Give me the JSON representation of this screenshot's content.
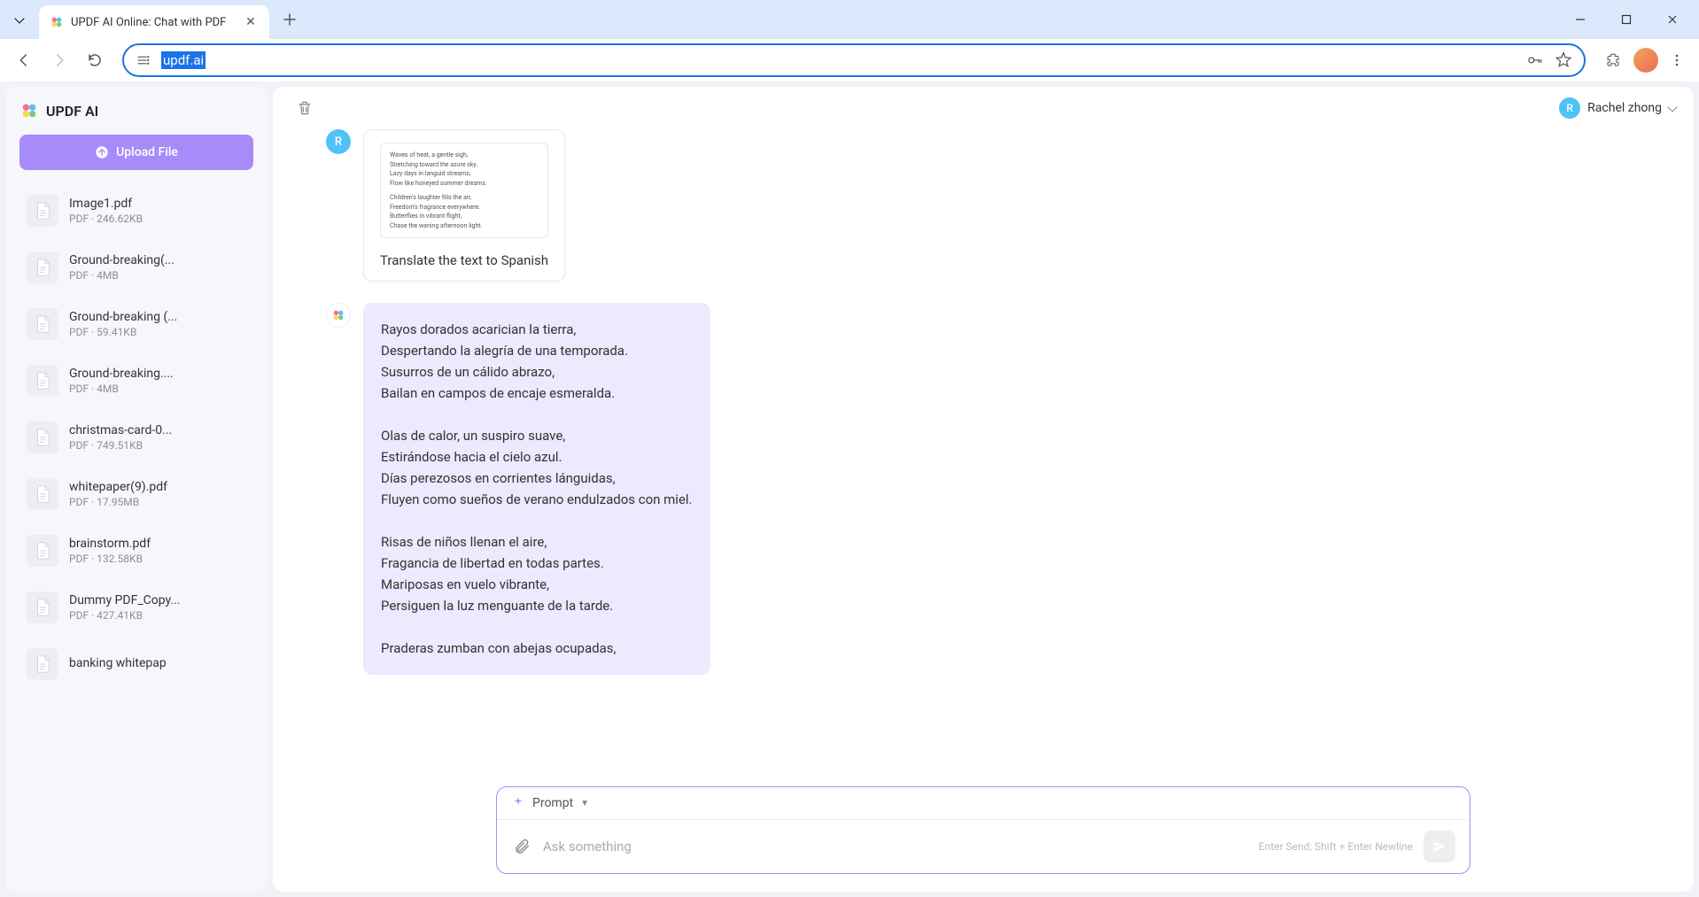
{
  "browser": {
    "tab_title": "UPDF AI Online: Chat with PDF",
    "url": "updf.ai"
  },
  "sidebar": {
    "title": "UPDF AI",
    "upload_label": "Upload File",
    "files": [
      {
        "name": "Image1.pdf",
        "meta": "PDF · 246.62KB"
      },
      {
        "name": "Ground-breaking(...",
        "meta": "PDF · 4MB"
      },
      {
        "name": "Ground-breaking (...",
        "meta": "PDF · 59.41KB"
      },
      {
        "name": "Ground-breaking....",
        "meta": "PDF · 4MB"
      },
      {
        "name": "christmas-card-0...",
        "meta": "PDF · 749.51KB"
      },
      {
        "name": "whitepaper(9).pdf",
        "meta": "PDF · 17.95MB"
      },
      {
        "name": "brainstorm.pdf",
        "meta": "PDF · 132.58KB"
      },
      {
        "name": "Dummy PDF_Copy...",
        "meta": "PDF · 427.41KB"
      },
      {
        "name": "banking whitepap",
        "meta": ""
      }
    ]
  },
  "header": {
    "user_initial": "R",
    "user_name": "Rachel zhong"
  },
  "chat": {
    "user_initial": "R",
    "user_message": "Translate the text to Spanish",
    "thumb_lines": [
      "Waves of heat, a gentle sigh,",
      "Stretching toward the azure sky.",
      "Lazy days in languid streams,",
      "Flow like honeyed summer dreams.",
      "",
      "Children's laughter fills the air,",
      "Freedom's fragrance everywhere.",
      "Butterflies in vibrant flight,",
      "Chase the waning afternoon light."
    ],
    "ai_response": "Rayos dorados acarician la tierra,\nDespertando la alegría de una temporada.\nSusurros de un cálido abrazo,\nBailan en campos de encaje esmeralda.\n\nOlas de calor, un suspiro suave,\nEstirándose hacia el cielo azul.\nDías perezosos en corrientes lánguidas,\nFluyen como sueños de verano endulzados con miel.\n\nRisas de niños llenan el aire,\nFragancia de libertad en todas partes.\nMariposas en vuelo vibrante,\nPersiguen la luz menguante de la tarde.\n\nPraderas zumban con abejas ocupadas,"
  },
  "input": {
    "prompt_label": "Prompt",
    "placeholder": "Ask something",
    "hint": "Enter Send; Shift + Enter Newline"
  }
}
